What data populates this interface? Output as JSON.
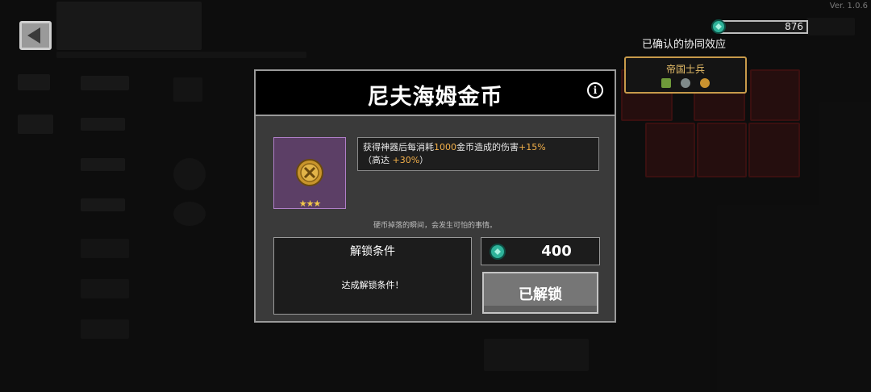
{
  "version": "Ver. 1.0.6",
  "currency": {
    "icon": "gem-icon",
    "amount": "876"
  },
  "synergy": {
    "heading": "已确认的协同效应",
    "name": "帝国士兵",
    "accent": "#c79a4a"
  },
  "modal": {
    "title": "尼夫海姆金币",
    "info_icon": "i",
    "item": {
      "rarity_stars": "★★★",
      "card_color": "#5c3f66"
    },
    "description": {
      "part1": "获得神器后每消耗",
      "amount": "1000",
      "part2": "金币造成的伤害",
      "bonus": "+15%",
      "line2_prefix": "（高达 ",
      "cap": "+30%",
      "line2_suffix": "）"
    },
    "flavor": "硬币掉落的瞬间，会发生可怕的事情。",
    "condition": {
      "title": "解锁条件",
      "value": "达成解锁条件！"
    },
    "price": {
      "icon": "gem-icon",
      "amount": "400"
    },
    "unlock_button": "已解锁"
  }
}
